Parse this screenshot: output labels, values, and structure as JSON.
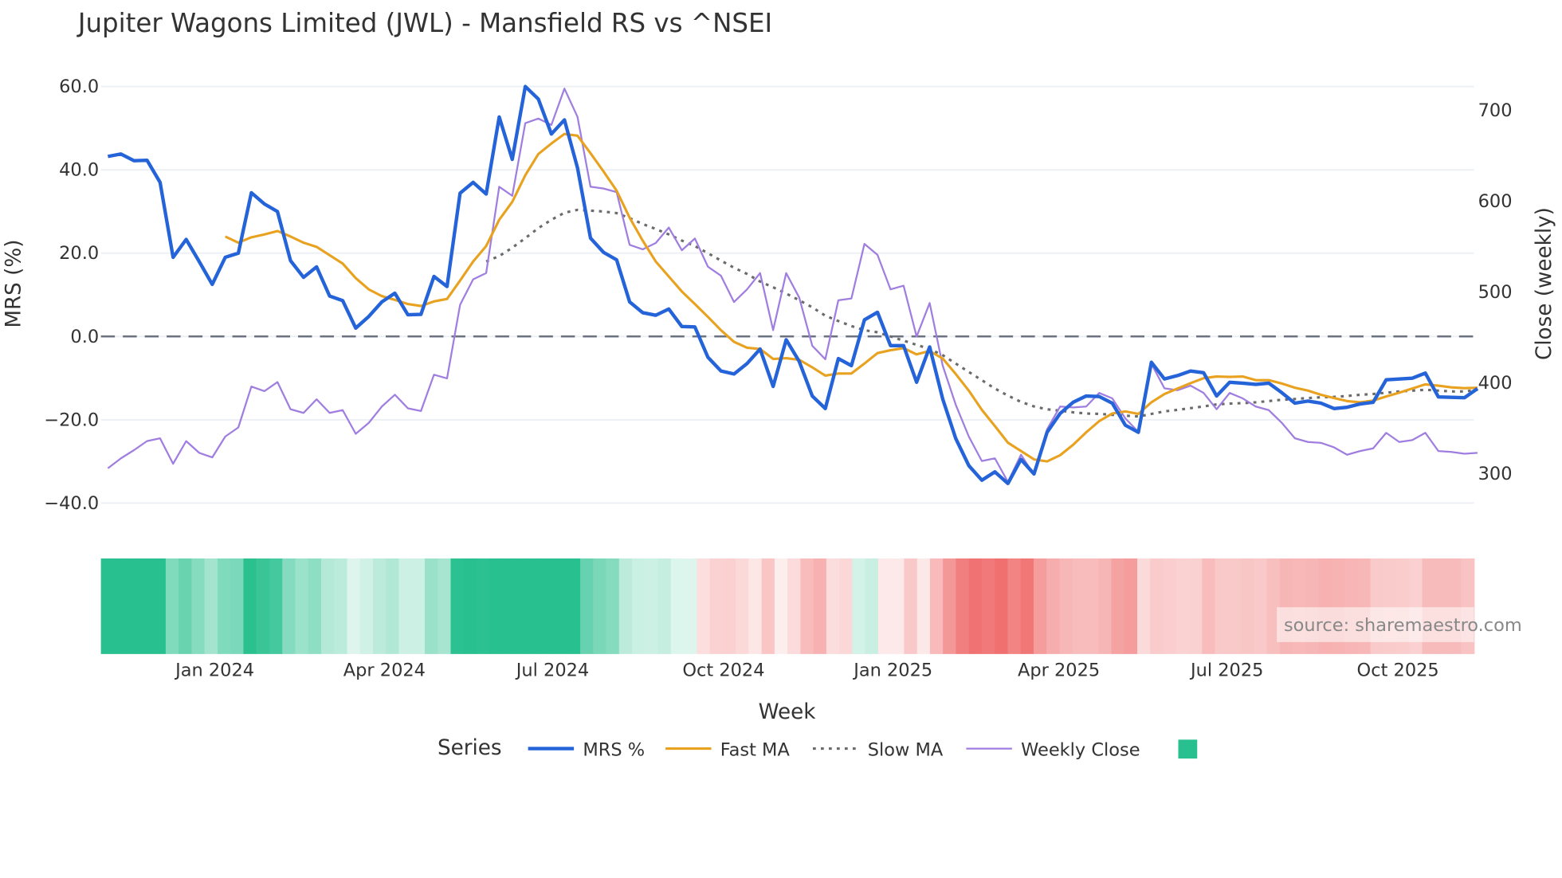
{
  "chart_data": {
    "type": "line",
    "title": "Jupiter Wagons Limited (JWL) - Mansfield RS vs ^NSEI",
    "xlabel": "Week",
    "ylabel": "MRS (%)",
    "y2label": "Close (weekly)",
    "ylim": [
      -45,
      63
    ],
    "y2lim": [
      260,
      735
    ],
    "yticks": [
      60,
      40,
      20,
      0,
      -20,
      -40
    ],
    "ytick_labels": [
      "60.0",
      "40.0",
      "20.0",
      "0.0",
      "−20.0",
      "−40.0"
    ],
    "y2ticks": [
      700,
      600,
      500,
      400,
      300
    ],
    "y2tick_labels": [
      "700",
      "600",
      "500",
      "400",
      "300"
    ],
    "xticks": [
      {
        "label": "Jan 2024",
        "week": 8.2
      },
      {
        "label": "Apr 2024",
        "week": 21.2
      },
      {
        "label": "Jul 2024",
        "week": 34.1
      },
      {
        "label": "Oct 2024",
        "week": 47.2
      },
      {
        "label": "Jan 2025",
        "week": 60.2
      },
      {
        "label": "Apr 2025",
        "week": 72.9
      },
      {
        "label": "Jul 2025",
        "week": 85.8
      },
      {
        "label": "Oct 2025",
        "week": 98.9
      }
    ],
    "zero_line": 0,
    "grid": true,
    "legend_title": "Series",
    "legend_position": "bottom",
    "series": [
      {
        "name": "MRS %",
        "axis": "y",
        "color": "#2563d9",
        "start": 0,
        "values": [
          43.2,
          43.8,
          42.2,
          42.3,
          37,
          19,
          23.3,
          18,
          12.5,
          19,
          20,
          34.5,
          31.8,
          30,
          18.2,
          14.2,
          16.7,
          9.7,
          8.6,
          2,
          4.8,
          8.3,
          10.4,
          5.2,
          5.3,
          14.4,
          12,
          34.4,
          37,
          34.2,
          52.7,
          42.5,
          60,
          57,
          48.6,
          52,
          40.5,
          23.6,
          20.2,
          18.4,
          8.3,
          5.7,
          5.1,
          6.6,
          2.4,
          2.3,
          -5,
          -8.3,
          -9,
          -6.5,
          -3,
          -12,
          -0.8,
          -6,
          -14.3,
          -17.3,
          -5.3,
          -7,
          4,
          5.8,
          -2.2,
          -2.2,
          -11,
          -2.5,
          -15,
          -24.5,
          -31,
          -34.5,
          -32.5,
          -35.3,
          -29.5,
          -33,
          -23,
          -18.5,
          -15.8,
          -14.3,
          -14.4,
          -16,
          -21.3,
          -23,
          -6.2,
          -10.2,
          -9.4,
          -8.3,
          -8.7,
          -14.3,
          -11,
          -11.2,
          -11.5,
          -11.2,
          -13.5,
          -16,
          -15.5,
          -16,
          -17.3,
          -17,
          -16.2,
          -15.8,
          -10.4,
          -10.2,
          -10,
          -8.8,
          -14.5,
          -14.6,
          -14.7,
          -12.5
        ]
      },
      {
        "name": "Fast MA",
        "axis": "y",
        "color": "#e8a21f",
        "start": 9,
        "values": [
          24,
          22.5,
          23.8,
          24.5,
          25.3,
          24,
          22.5,
          21.5,
          19.5,
          17.5,
          14,
          11.3,
          9.7,
          8.8,
          7.8,
          7.3,
          8.4,
          9,
          13.4,
          18,
          21.7,
          28,
          32.3,
          38.7,
          43.8,
          46.3,
          48.6,
          48.2,
          44,
          39.6,
          35,
          28.5,
          23,
          18,
          14.4,
          10.8,
          7.8,
          4.7,
          1.5,
          -1.3,
          -2.7,
          -3,
          -5.4,
          -5.2,
          -5.6,
          -7.4,
          -9.4,
          -8.9,
          -8.9,
          -6.5,
          -4,
          -3.3,
          -2.8,
          -4.3,
          -3.5,
          -5.3,
          -9,
          -13,
          -17.6,
          -21.5,
          -25.5,
          -27.5,
          -29.5,
          -30,
          -28.5,
          -26,
          -23,
          -20.3,
          -18.5,
          -18,
          -18.6,
          -15.8,
          -13.8,
          -12.5,
          -11.2,
          -10,
          -9.6,
          -9.7,
          -9.6,
          -10.5,
          -10.5,
          -11.3,
          -12.3,
          -13,
          -14,
          -14.8,
          -15.5,
          -15.8,
          -15.4,
          -14.4,
          -13.5,
          -12.5,
          -11.5,
          -11.8,
          -12.2,
          -12.4,
          -12.3
        ]
      },
      {
        "name": "Slow MA",
        "axis": "y",
        "color": "#6b6b6b",
        "start": 29,
        "values": [
          18,
          19.3,
          21.3,
          23.6,
          26,
          28,
          29.7,
          30.4,
          30.2,
          30,
          29.6,
          28.4,
          27,
          25.8,
          24.5,
          23,
          21.7,
          20,
          18.2,
          16.5,
          15,
          13.2,
          11.8,
          10.3,
          8.7,
          7,
          5,
          3.7,
          2.5,
          1.5,
          1,
          0,
          -1,
          -2,
          -3,
          -4.5,
          -6.5,
          -8.5,
          -10.5,
          -12.5,
          -14.2,
          -15.7,
          -16.8,
          -17.5,
          -17.8,
          -18.2,
          -18.5,
          -18.6,
          -18.8,
          -19,
          -19.2,
          -18.6,
          -18,
          -17.6,
          -17.2,
          -16.8,
          -16.3,
          -16.1,
          -16,
          -15.8,
          -15.5,
          -15.2,
          -15,
          -14.8,
          -14.6,
          -14.5,
          -14.3,
          -14,
          -13.8,
          -13.5,
          -13.2,
          -13,
          -12.8,
          -13,
          -13.2,
          -13.2,
          -12.8
        ]
      },
      {
        "name": "Weekly Close",
        "axis": "y2",
        "color": "#a07ee0",
        "start": 0,
        "values": [
          305,
          316,
          325,
          335,
          338,
          310,
          335,
          322,
          317,
          340,
          350,
          395,
          390,
          400,
          370,
          366,
          381,
          366,
          369,
          343,
          355,
          373,
          386,
          371,
          368,
          408,
          404,
          485,
          513,
          520,
          615,
          605,
          685,
          690,
          683,
          723,
          692,
          615,
          613,
          609,
          551,
          546,
          553,
          570,
          545,
          558,
          527,
          517,
          488,
          502,
          520,
          457,
          520,
          493,
          440,
          425,
          490,
          492,
          552,
          540,
          502,
          506,
          450,
          487,
          418,
          375,
          340,
          313,
          316,
          290,
          320,
          298,
          348,
          373,
          372,
          373,
          388,
          382,
          360,
          345,
          420,
          393,
          391,
          396,
          388,
          370,
          388,
          382,
          373,
          369,
          355,
          338,
          334,
          333,
          328,
          320,
          324,
          327,
          344,
          334,
          336,
          344,
          324,
          323,
          321,
          322
        ]
      }
    ],
    "heatmap": {
      "source_series": "MRS %",
      "positive_color": "#28c08e",
      "negative_color": "#f07070"
    }
  },
  "watermark": "source: sharemaestro.com"
}
